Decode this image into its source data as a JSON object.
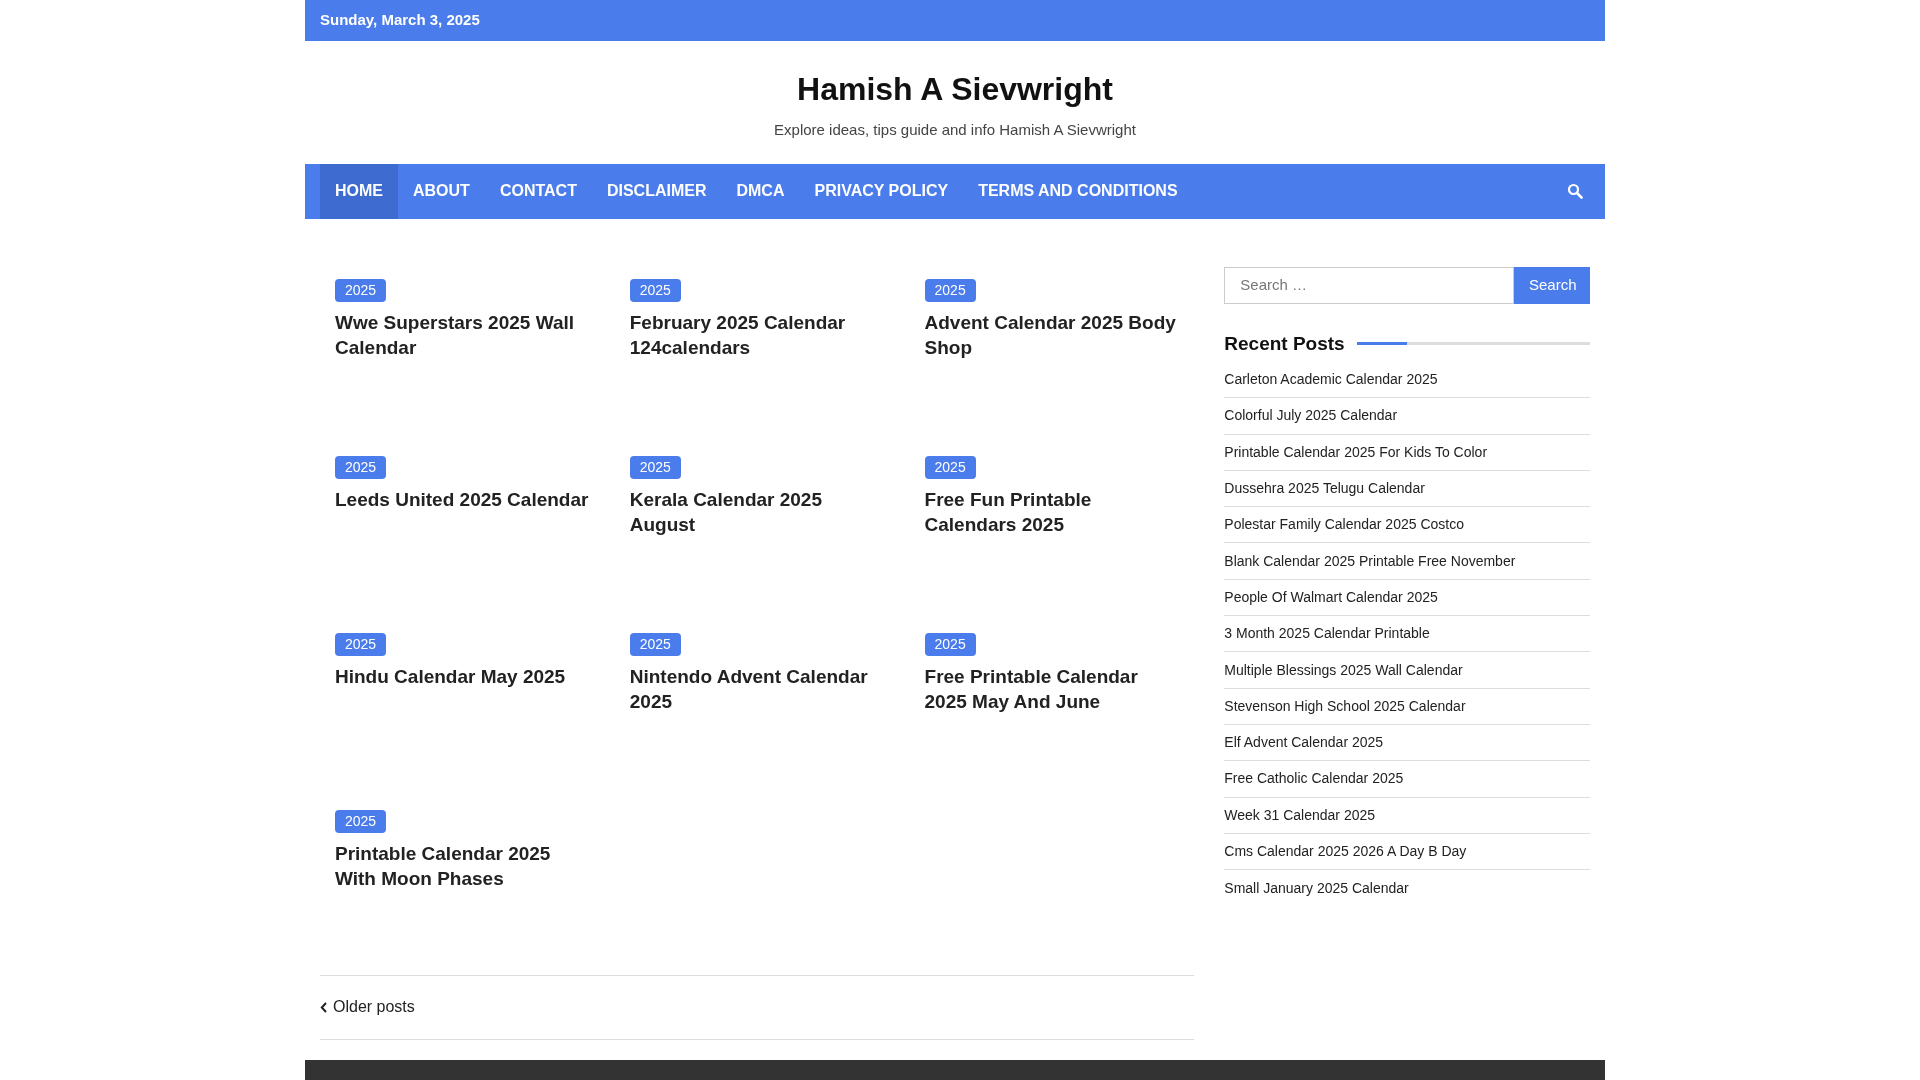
{
  "top_bar": {
    "date": "Sunday, March 3, 2025"
  },
  "header": {
    "site_title": "Hamish A Sievwright",
    "tagline": "Explore ideas, tips guide and info Hamish A Sievwright"
  },
  "nav": {
    "items": [
      {
        "label": "HOME",
        "selected": true
      },
      {
        "label": "ABOUT",
        "selected": false
      },
      {
        "label": "CONTACT",
        "selected": false
      },
      {
        "label": "DISCLAIMER",
        "selected": false
      },
      {
        "label": "DMCA",
        "selected": false
      },
      {
        "label": "PRIVACY POLICY",
        "selected": false
      },
      {
        "label": "TERMS AND CONDITIONS",
        "selected": false
      }
    ]
  },
  "posts": [
    {
      "category": "2025",
      "title": "Wwe Superstars 2025 Wall Calendar"
    },
    {
      "category": "2025",
      "title": "February 2025 Calendar 124calendars"
    },
    {
      "category": "2025",
      "title": "Advent Calendar 2025 Body Shop"
    },
    {
      "category": "2025",
      "title": "Leeds United 2025 Calendar"
    },
    {
      "category": "2025",
      "title": "Kerala Calendar 2025 August"
    },
    {
      "category": "2025",
      "title": "Free Fun Printable Calendars 2025"
    },
    {
      "category": "2025",
      "title": "Hindu Calendar May 2025"
    },
    {
      "category": "2025",
      "title": "Nintendo Advent Calendar 2025"
    },
    {
      "category": "2025",
      "title": "Free Printable Calendar 2025 May And June"
    },
    {
      "category": "2025",
      "title": "Printable Calendar 2025 With Moon Phases"
    }
  ],
  "pagination": {
    "older": "Older posts"
  },
  "sidebar": {
    "search": {
      "placeholder": "Search …",
      "button": "Search"
    },
    "recent_posts": {
      "title": "Recent Posts",
      "items": [
        "Carleton Academic Calendar 2025",
        "Colorful July 2025 Calendar",
        "Printable Calendar 2025 For Kids To Color",
        "Dussehra 2025 Telugu Calendar",
        "Polestar Family Calendar 2025 Costco",
        "Blank Calendar 2025 Printable Free November",
        "People Of Walmart Calendar 2025",
        "3 Month 2025 Calendar Printable",
        "Multiple Blessings 2025 Wall Calendar",
        "Stevenson High School 2025 Calendar",
        "Elf Advent Calendar 2025",
        "Free Catholic Calendar 2025",
        "Week 31 Calendar 2025",
        "Cms Calendar 2025 2026 A Day B Day",
        "Small January 2025 Calendar"
      ]
    }
  }
}
